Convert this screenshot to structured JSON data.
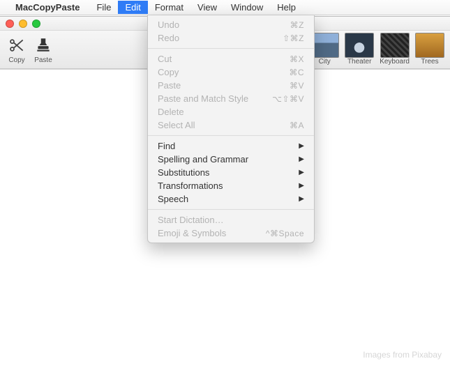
{
  "menubar": {
    "app_name": "MacCopyPaste",
    "items": [
      "File",
      "Edit",
      "Format",
      "View",
      "Window",
      "Help"
    ],
    "active_index": 1
  },
  "toolbar": {
    "copy_label": "Copy",
    "paste_label": "Paste"
  },
  "thumbs": [
    {
      "label": "City",
      "style": "city"
    },
    {
      "label": "Theater",
      "style": "theater"
    },
    {
      "label": "Keyboard",
      "style": "keyboard"
    },
    {
      "label": "Trees",
      "style": "trees"
    }
  ],
  "dropdown": [
    {
      "label": "Undo",
      "shortcut": "⌘Z",
      "disabled": true
    },
    {
      "label": "Redo",
      "shortcut": "⇧⌘Z",
      "disabled": true
    },
    {
      "sep": true
    },
    {
      "label": "Cut",
      "shortcut": "⌘X",
      "disabled": true
    },
    {
      "label": "Copy",
      "shortcut": "⌘C",
      "disabled": true
    },
    {
      "label": "Paste",
      "shortcut": "⌘V",
      "disabled": true
    },
    {
      "label": "Paste and Match Style",
      "shortcut": "⌥⇧⌘V",
      "disabled": true
    },
    {
      "label": "Delete",
      "shortcut": "",
      "disabled": true
    },
    {
      "label": "Select All",
      "shortcut": "⌘A",
      "disabled": true
    },
    {
      "sep": true
    },
    {
      "label": "Find",
      "submenu": true,
      "disabled": false
    },
    {
      "label": "Spelling and Grammar",
      "submenu": true,
      "disabled": false
    },
    {
      "label": "Substitutions",
      "submenu": true,
      "disabled": false
    },
    {
      "label": "Transformations",
      "submenu": true,
      "disabled": false
    },
    {
      "label": "Speech",
      "submenu": true,
      "disabled": false
    },
    {
      "sep": true
    },
    {
      "label": "Start Dictation…",
      "shortcut": "",
      "disabled": true
    },
    {
      "label": "Emoji & Symbols",
      "shortcut": "^⌘Space",
      "disabled": true
    }
  ],
  "watermark": "Images from Pixabay"
}
